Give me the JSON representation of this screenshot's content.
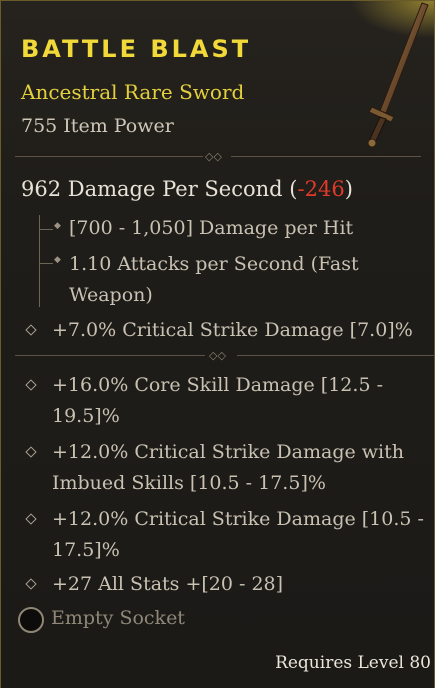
{
  "item": {
    "name": "BATTLE BLAST",
    "type": "Ancestral Rare Sword",
    "item_power": "755 Item Power",
    "dps_value": "962 Damage Per Second",
    "dps_open": "(",
    "dps_delta": "-246",
    "dps_close": ")",
    "dps_details": [
      "[700 - 1,050] Damage per Hit",
      "1.10 Attacks per Second (Fast",
      "Weapon)"
    ],
    "implicit": "+7.0% Critical Strike Damage [7.0]%",
    "affixes": [
      {
        "line1": "+16.0% Core Skill Damage [12.5 -",
        "line2": "19.5]%"
      },
      {
        "line1": "+12.0% Critical Strike Damage with",
        "line2": "Imbued Skills [10.5 - 17.5]%"
      },
      {
        "line1": "+12.0% Critical Strike Damage [10.5 -",
        "line2": "17.5]%"
      },
      {
        "line1": "+27 All Stats +[20 - 28]"
      }
    ],
    "socket": "Empty Socket",
    "requirement": "Requires Level 80"
  },
  "colors": {
    "title": "#f2d93a",
    "rarity": "#e3d03c",
    "negative": "#e03a2a",
    "text": "#c9c1b2"
  },
  "icons": [
    "sword-icon",
    "divider-ornament-icon",
    "bullet-diamond-icon",
    "socket-icon"
  ]
}
